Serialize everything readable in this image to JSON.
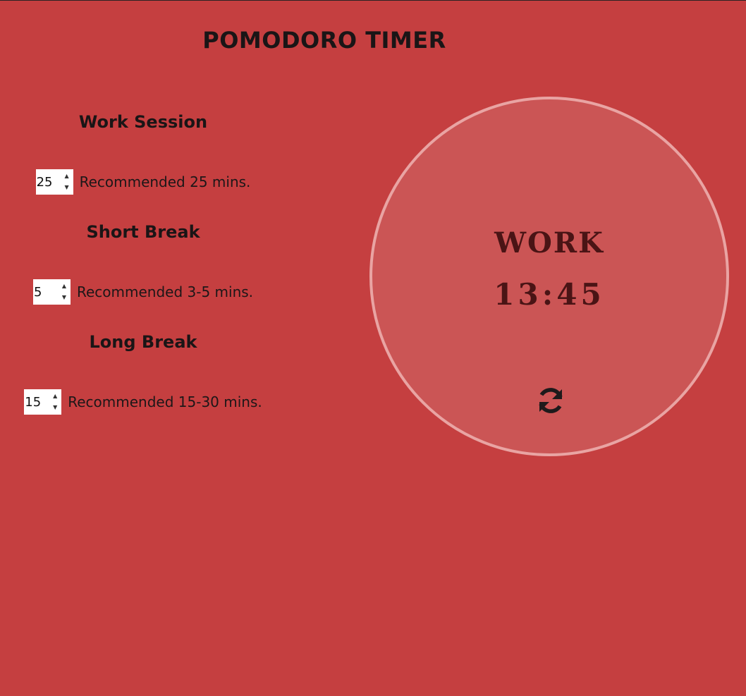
{
  "header": {
    "title": "POMODORO TIMER"
  },
  "settings": {
    "work": {
      "heading": "Work Session",
      "value": "25",
      "recommendation": "Recommended 25 mins."
    },
    "short_break": {
      "heading": "Short Break",
      "value": "5",
      "recommendation": "Recommended 3-5 mins."
    },
    "long_break": {
      "heading": "Long Break",
      "value": "15",
      "recommendation": "Recommended 15-30 mins."
    }
  },
  "timer": {
    "mode": "WORK",
    "time": "13:45",
    "reset_icon": "refresh-icon"
  },
  "colors": {
    "background": "#c53f40",
    "circle_fill": "#cb5555",
    "circle_border": "#e9a4a3",
    "timer_text": "#4a1415",
    "text": "#1c1718"
  }
}
